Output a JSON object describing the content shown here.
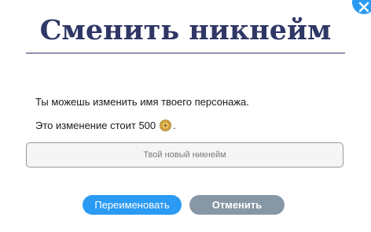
{
  "dialog": {
    "title": "Сменить никнейм",
    "line1": "Ты можешь изменить имя твоего персонажа.",
    "line2_prefix": "Это изменение стоит 500",
    "line2_suffix": ".",
    "coin_icon": "coin-icon",
    "input": {
      "placeholder": "Твой новый никнейм",
      "value": ""
    },
    "rename_label": "Переименовать",
    "cancel_label": "Отменить",
    "close_icon": "close-icon"
  },
  "colors": {
    "title": "#2f3766",
    "primary_button": "#2b9af3",
    "secondary_button": "#8797a6"
  }
}
